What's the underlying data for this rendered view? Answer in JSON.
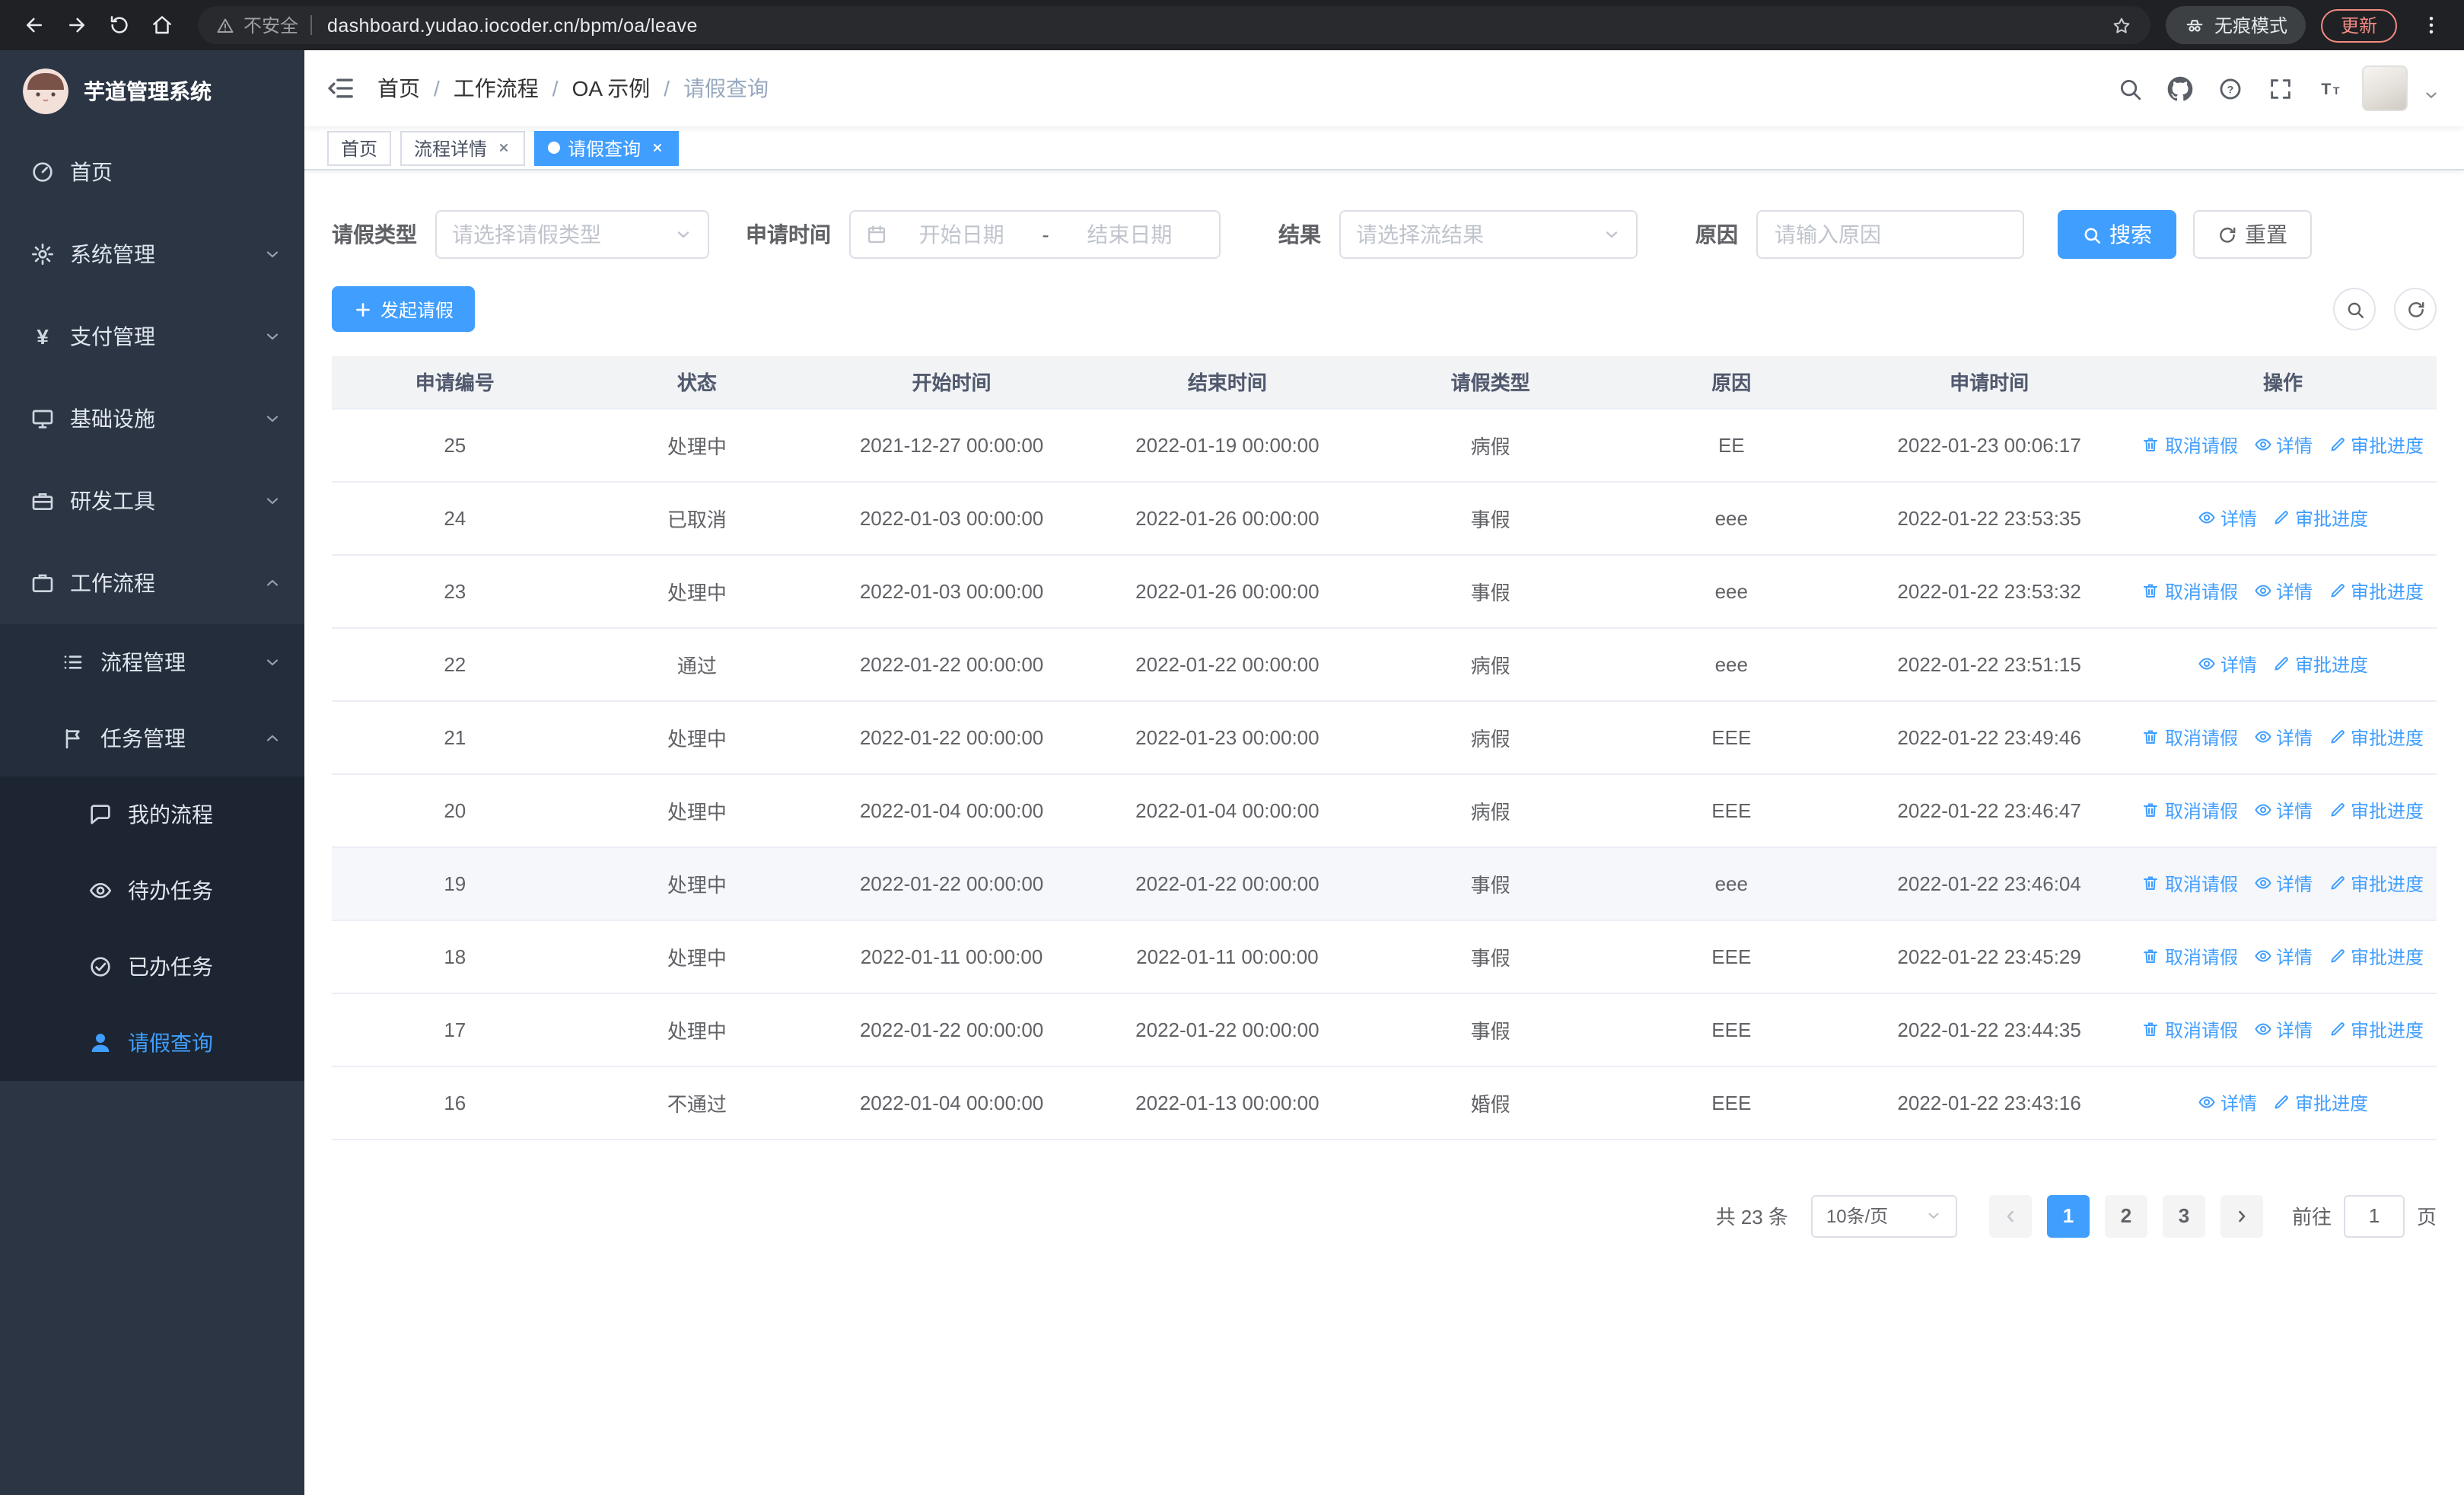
{
  "browser": {
    "security_label": "不安全",
    "url": "dashboard.yudao.iocoder.cn/bpm/oa/leave",
    "incognito_label": "无痕模式",
    "update_label": "更新"
  },
  "sidebar": {
    "logo_title": "芋道管理系统",
    "items": [
      {
        "label": "首页",
        "icon": "dashboard-icon"
      },
      {
        "label": "系统管理",
        "icon": "gear-icon",
        "state": "collapsed"
      },
      {
        "label": "支付管理",
        "icon": "yen-icon",
        "state": "collapsed"
      },
      {
        "label": "基础设施",
        "icon": "monitor-icon",
        "state": "collapsed"
      },
      {
        "label": "研发工具",
        "icon": "toolbox-icon",
        "state": "collapsed"
      },
      {
        "label": "工作流程",
        "icon": "briefcase-icon",
        "state": "expanded"
      },
      {
        "label": "流程管理",
        "icon": "list-icon",
        "state": "collapsed"
      },
      {
        "label": "任务管理",
        "icon": "flag-icon",
        "state": "expanded"
      },
      {
        "label": "我的流程",
        "icon": "chat-icon"
      },
      {
        "label": "待办任务",
        "icon": "eye-icon"
      },
      {
        "label": "已办任务",
        "icon": "check-circle-icon"
      },
      {
        "label": "请假查询",
        "icon": "user-icon",
        "active": true
      }
    ]
  },
  "header": {
    "breadcrumb": [
      "首页",
      "工作流程",
      "OA 示例",
      "请假查询"
    ],
    "separator": "/"
  },
  "tabs": [
    {
      "label": "首页",
      "active": false,
      "closable": false
    },
    {
      "label": "流程详情",
      "active": false,
      "closable": true
    },
    {
      "label": "请假查询",
      "active": true,
      "closable": true
    }
  ],
  "filters": {
    "leave_type_label": "请假类型",
    "leave_type_placeholder": "请选择请假类型",
    "apply_time_label": "申请时间",
    "start_date_placeholder": "开始日期",
    "range_separator": "-",
    "end_date_placeholder": "结束日期",
    "result_label": "结果",
    "result_placeholder": "请选择流结果",
    "reason_label": "原因",
    "reason_placeholder": "请输入原因",
    "search_label": "搜索",
    "reset_label": "重置"
  },
  "toolbar": {
    "create_label": "发起请假"
  },
  "table": {
    "columns": [
      "申请编号",
      "状态",
      "开始时间",
      "结束时间",
      "请假类型",
      "原因",
      "申请时间",
      "操作"
    ],
    "rows": [
      {
        "id": "25",
        "status": "处理中",
        "start": "2021-12-27 00:00:00",
        "end": "2022-01-19 00:00:00",
        "type": "病假",
        "reason": "EE",
        "apply_time": "2022-01-23 00:06:17",
        "highlighted": false,
        "actions": [
          {
            "label": "取消请假",
            "icon": "delete-icon",
            "name": "cancel-leave-link"
          },
          {
            "label": "详情",
            "icon": "view-icon",
            "name": "detail-link"
          },
          {
            "label": "审批进度",
            "icon": "edit-icon",
            "name": "approval-progress-link"
          }
        ]
      },
      {
        "id": "24",
        "status": "已取消",
        "start": "2022-01-03 00:00:00",
        "end": "2022-01-26 00:00:00",
        "type": "事假",
        "reason": "eee",
        "apply_time": "2022-01-22 23:53:35",
        "highlighted": false,
        "actions": [
          {
            "label": "详情",
            "icon": "view-icon",
            "name": "detail-link"
          },
          {
            "label": "审批进度",
            "icon": "edit-icon",
            "name": "approval-progress-link"
          }
        ]
      },
      {
        "id": "23",
        "status": "处理中",
        "start": "2022-01-03 00:00:00",
        "end": "2022-01-26 00:00:00",
        "type": "事假",
        "reason": "eee",
        "apply_time": "2022-01-22 23:53:32",
        "highlighted": false,
        "actions": [
          {
            "label": "取消请假",
            "icon": "delete-icon",
            "name": "cancel-leave-link"
          },
          {
            "label": "详情",
            "icon": "view-icon",
            "name": "detail-link"
          },
          {
            "label": "审批进度",
            "icon": "edit-icon",
            "name": "approval-progress-link"
          }
        ]
      },
      {
        "id": "22",
        "status": "通过",
        "start": "2022-01-22 00:00:00",
        "end": "2022-01-22 00:00:00",
        "type": "病假",
        "reason": "eee",
        "apply_time": "2022-01-22 23:51:15",
        "highlighted": false,
        "actions": [
          {
            "label": "详情",
            "icon": "view-icon",
            "name": "detail-link"
          },
          {
            "label": "审批进度",
            "icon": "edit-icon",
            "name": "approval-progress-link"
          }
        ]
      },
      {
        "id": "21",
        "status": "处理中",
        "start": "2022-01-22 00:00:00",
        "end": "2022-01-23 00:00:00",
        "type": "病假",
        "reason": "EEE",
        "apply_time": "2022-01-22 23:49:46",
        "highlighted": false,
        "actions": [
          {
            "label": "取消请假",
            "icon": "delete-icon",
            "name": "cancel-leave-link"
          },
          {
            "label": "详情",
            "icon": "view-icon",
            "name": "detail-link"
          },
          {
            "label": "审批进度",
            "icon": "edit-icon",
            "name": "approval-progress-link"
          }
        ]
      },
      {
        "id": "20",
        "status": "处理中",
        "start": "2022-01-04 00:00:00",
        "end": "2022-01-04 00:00:00",
        "type": "病假",
        "reason": "EEE",
        "apply_time": "2022-01-22 23:46:47",
        "highlighted": false,
        "actions": [
          {
            "label": "取消请假",
            "icon": "delete-icon",
            "name": "cancel-leave-link"
          },
          {
            "label": "详情",
            "icon": "view-icon",
            "name": "detail-link"
          },
          {
            "label": "审批进度",
            "icon": "edit-icon",
            "name": "approval-progress-link"
          }
        ]
      },
      {
        "id": "19",
        "status": "处理中",
        "start": "2022-01-22 00:00:00",
        "end": "2022-01-22 00:00:00",
        "type": "事假",
        "reason": "eee",
        "apply_time": "2022-01-22 23:46:04",
        "highlighted": true,
        "actions": [
          {
            "label": "取消请假",
            "icon": "delete-icon",
            "name": "cancel-leave-link"
          },
          {
            "label": "详情",
            "icon": "view-icon",
            "name": "detail-link"
          },
          {
            "label": "审批进度",
            "icon": "edit-icon",
            "name": "approval-progress-link"
          }
        ]
      },
      {
        "id": "18",
        "status": "处理中",
        "start": "2022-01-11 00:00:00",
        "end": "2022-01-11 00:00:00",
        "type": "事假",
        "reason": "EEE",
        "apply_time": "2022-01-22 23:45:29",
        "highlighted": false,
        "actions": [
          {
            "label": "取消请假",
            "icon": "delete-icon",
            "name": "cancel-leave-link"
          },
          {
            "label": "详情",
            "icon": "view-icon",
            "name": "detail-link"
          },
          {
            "label": "审批进度",
            "icon": "edit-icon",
            "name": "approval-progress-link"
          }
        ]
      },
      {
        "id": "17",
        "status": "处理中",
        "start": "2022-01-22 00:00:00",
        "end": "2022-01-22 00:00:00",
        "type": "事假",
        "reason": "EEE",
        "apply_time": "2022-01-22 23:44:35",
        "highlighted": false,
        "actions": [
          {
            "label": "取消请假",
            "icon": "delete-icon",
            "name": "cancel-leave-link"
          },
          {
            "label": "详情",
            "icon": "view-icon",
            "name": "detail-link"
          },
          {
            "label": "审批进度",
            "icon": "edit-icon",
            "name": "approval-progress-link"
          }
        ]
      },
      {
        "id": "16",
        "status": "不通过",
        "start": "2022-01-04 00:00:00",
        "end": "2022-01-13 00:00:00",
        "type": "婚假",
        "reason": "EEE",
        "apply_time": "2022-01-22 23:43:16",
        "highlighted": false,
        "actions": [
          {
            "label": "详情",
            "icon": "view-icon",
            "name": "detail-link"
          },
          {
            "label": "审批进度",
            "icon": "edit-icon",
            "name": "approval-progress-link"
          }
        ]
      }
    ]
  },
  "pagination": {
    "total_label": "共 23 条",
    "page_size_label": "10条/页",
    "pages": [
      "1",
      "2",
      "3"
    ],
    "active_page": "1",
    "goto_label": "前往",
    "goto_value": "1",
    "page_suffix": "页"
  },
  "colors": {
    "primary": "#409eff",
    "sidebar_bg": "#2b3544",
    "active_tab_bg": "#409eff",
    "update_badge": "#f28b82"
  }
}
